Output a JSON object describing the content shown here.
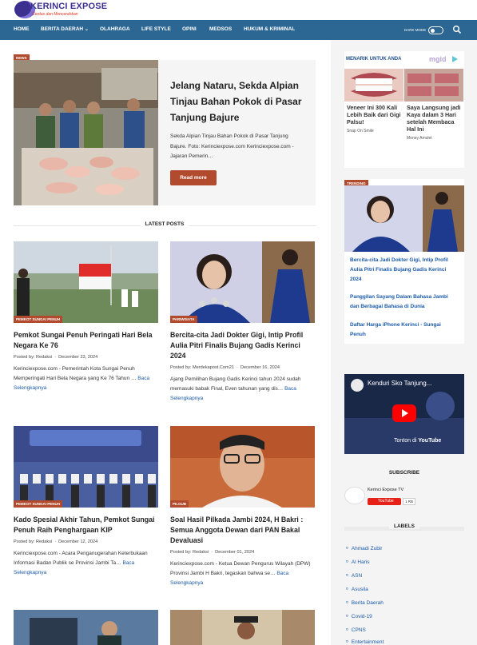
{
  "site": {
    "logo_text": "KERINCI EXPOSE",
    "tagline": "Cerdas dan Mencerahkan"
  },
  "nav": {
    "items": [
      "HOME",
      "BERITA DAERAH",
      "OLAHRAGA",
      "LIFE STYLE",
      "OPINI",
      "MEDSOS",
      "HUKUM & KRIMINAL"
    ],
    "dark_mode_label": "DARK MODE"
  },
  "hero": {
    "badge": "NEWS",
    "title": "Jelang Nataru, Sekda Alpian Tinjau Bahan Pokok di Pasar Tanjung Bajure",
    "excerpt": "Sekda Alpian Tinjau Bahan Pokok di Pasar Tanjung Bajure. Foto: Kerinciexpose.com Kerinciexpose.com - Jajaran Pemerin…",
    "button": "Read more"
  },
  "latest": {
    "heading": "LATEST POSTS",
    "posted_by": "Posted by:",
    "read_more": "Baca Selengkapnya",
    "posts": [
      {
        "category": "PEMKOT SUNGAI PENUH",
        "title": "Pemkot Sungai Penuh Peringati Hari Bela Negara Ke 76",
        "author": "Redaksi",
        "date": "December 23, 2024",
        "excerpt": "Kerinciexpose.com - Pemerintah Kota Sungai Penuh Memperingati Hari Bela Negara yang Ke 76 Tahun …"
      },
      {
        "category": "PARIWISATA",
        "title": "Bercita-cita Jadi Dokter Gigi, Intip Profil Aulia Pitri Finalis Bujang Gadis Kerinci 2024",
        "author": "Merdekapost.Com21",
        "date": "December 16, 2024",
        "excerpt": "Ajang Pemilihan Bujang Gadis Kerinci tahun 2024 sudah memasuki babak Final, Even tahunan yang dis…"
      },
      {
        "category": "PEMKOT SUNGAI PENUH",
        "title": "Kado Spesial Akhir Tahun, Pemkot Sungai Penuh Raih Penghargaan KIP",
        "author": "Redaksi",
        "date": "December 12, 2024",
        "excerpt": "Kerinciexpose.com - Acara Penganugerahan Keterbukaan Informasi Badan Publik se Provinsi Jambi Ta…"
      },
      {
        "category": "PILGUB",
        "title": "Soal Hasil Pilkada Jambi 2024, H Bakri : Semua Anggota Dewan dari PAN Bakal Devaluasi",
        "author": "Redaksi",
        "date": "December 01, 2024",
        "excerpt": "Kerinciexpose.com - Ketua Dewan Pengurus Wilayah (DPW) Provinsi Jambi H Bakri, tegaskan bahwa se…"
      }
    ]
  },
  "mgid": {
    "heading": "MENARIK UNTUK ANDA",
    "logo": "mgid",
    "ads": [
      {
        "title": "Veneer Ini 300 Kali Lebih Baik dari Gigi Palsu!",
        "source": "Snap On Smile"
      },
      {
        "title": "Saya Langsung jadi Kaya dalam 3 Hari setelah Membaca Hal Ini",
        "source": "Money Amulet"
      }
    ]
  },
  "trending": {
    "badge": "TRENDING",
    "links": [
      "Bercita-cita Jadi Dokter Gigi, Intip Profil Aulia Pitri Finalis Bujang Gadis Kerinci 2024",
      "Panggilan Sayang Dalam Bahasa Jambi dan Berbagai Bahasa di Dunia",
      "Daftar Harga iPhone Kerinci - Sungai Penuh"
    ]
  },
  "video": {
    "title": "Kenduri Sko Tanjung...",
    "watch_on": "Tonton di",
    "platform": "YouTube"
  },
  "subscribe": {
    "heading": "SUBSCRIBE",
    "channel": "Kerinci Expose TV",
    "button": "YouTube",
    "count": "1 RB"
  },
  "labels": {
    "heading": "LABELS",
    "items": [
      "Ahmadi Zubir",
      "Al Haris",
      "ASN",
      "Asusila",
      "Berita Daerah",
      "Covid-19",
      "CPNS",
      "Entertainment"
    ]
  },
  "colors": {
    "nav_bg": "#2c6794",
    "accent": "#b24a2d",
    "link": "#1a5aa8"
  }
}
